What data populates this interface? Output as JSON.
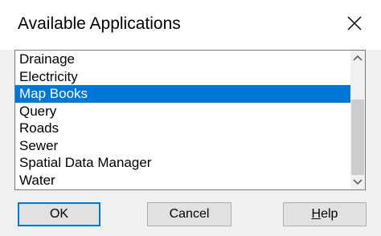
{
  "dialog": {
    "title": "Available Applications",
    "close_icon": "close-icon"
  },
  "listbox": {
    "items": [
      {
        "label": "Drainage",
        "selected": false
      },
      {
        "label": "Electricity",
        "selected": false
      },
      {
        "label": "Map Books",
        "selected": true
      },
      {
        "label": "Query",
        "selected": false
      },
      {
        "label": "Roads",
        "selected": false
      },
      {
        "label": "Sewer",
        "selected": false
      },
      {
        "label": "Spatial Data Manager",
        "selected": false
      },
      {
        "label": "Water",
        "selected": false
      }
    ],
    "selection_color": "#0078d7"
  },
  "scrollbar": {
    "up_icon": "chevron-up-icon",
    "down_icon": "chevron-down-icon"
  },
  "buttons": {
    "ok_label": "OK",
    "cancel_label": "Cancel",
    "help_mnemonic": "H",
    "help_rest": "elp"
  }
}
